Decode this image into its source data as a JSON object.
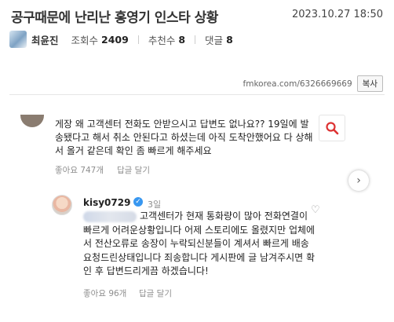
{
  "post": {
    "title": "공구때문에 난리난 홍영기 인스타 상황",
    "date": "2023.10.27 18:50",
    "author": "최윤진",
    "views_label": "조회수",
    "views": "2409",
    "recommend_label": "추천수",
    "recommend": "8",
    "comments_label": "댓글",
    "comments": "8",
    "url": "fmkorea.com/6326669669",
    "copy_label": "복사"
  },
  "screenshot": {
    "comment": {
      "text": "게장 왜 고객센터 전화도 안받으시고 답변도 없나요?? 19일에 발송됐다고 해서 취소 안된다고 하셨는데 아직 도착안했어요 다 상해서 올거 같은데 확인 좀 빠르게 해주세요",
      "likes": "좋아요 747개",
      "reply_action": "답글 달기"
    },
    "reply": {
      "username": "kisy0729",
      "verified_mark": "✓",
      "time": "3일",
      "text": "고객센터가 현재 통화량이 많아 전화연결이 빠르게 어려운상황입니다 어제 스토리에도 올렸지만 업체에서 전산오류로 송장이 누락되신분들이 계셔서 빠르게 배송 요청드린상태입니다 죄송합니다 게시판에 글 남겨주시면 확인 후 답변드리게끔 하겠습니다!",
      "likes": "좋아요 96개",
      "reply_action": "답글 달기"
    }
  }
}
